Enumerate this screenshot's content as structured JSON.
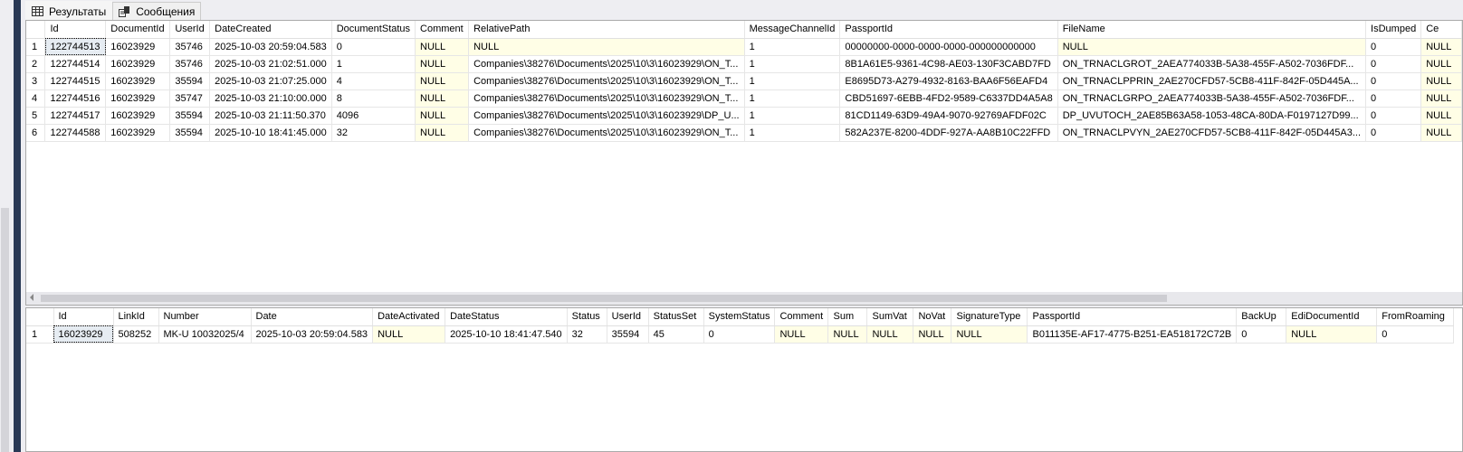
{
  "tabs": [
    {
      "label": "Результаты",
      "icon": "grid-icon"
    },
    {
      "label": "Сообщения",
      "icon": "messages-icon"
    }
  ],
  "grid1": {
    "columns": [
      "",
      "Id",
      "DocumentId",
      "UserId",
      "DateCreated",
      "DocumentStatus",
      "Comment",
      "RelativePath",
      "MessageChannelId",
      "PassportId",
      "FileName",
      "IsDumped",
      "Ce"
    ],
    "rows": [
      [
        "1",
        "122744513",
        "16023929",
        "35746",
        "2025-10-03 20:59:04.583",
        "0",
        "NULL",
        "NULL",
        "1",
        "00000000-0000-0000-0000-000000000000",
        "NULL",
        "0",
        "NULL"
      ],
      [
        "2",
        "122744514",
        "16023929",
        "35746",
        "2025-10-03 21:02:51.000",
        "1",
        "NULL",
        "Companies\\38276\\Documents\\2025\\10\\3\\16023929\\ON_T...",
        "1",
        "8B1A61E5-9361-4C98-AE03-130F3CABD7FD",
        "ON_TRNACLGROT_2AEA774033B-5A38-455F-A502-7036FDF...",
        "0",
        "NULL"
      ],
      [
        "3",
        "122744515",
        "16023929",
        "35594",
        "2025-10-03 21:07:25.000",
        "4",
        "NULL",
        "Companies\\38276\\Documents\\2025\\10\\3\\16023929\\ON_T...",
        "1",
        "E8695D73-A279-4932-8163-BAA6F56EAFD4",
        "ON_TRNACLPPRIN_2AE270CFD57-5CB8-411F-842F-05D445A...",
        "0",
        "NULL"
      ],
      [
        "4",
        "122744516",
        "16023929",
        "35747",
        "2025-10-03 21:10:00.000",
        "8",
        "NULL",
        "Companies\\38276\\Documents\\2025\\10\\3\\16023929\\ON_T...",
        "1",
        "CBD51697-6EBB-4FD2-9589-C6337DD4A5A8",
        "ON_TRNACLGRPO_2AEA774033B-5A38-455F-A502-7036FDF...",
        "0",
        "NULL"
      ],
      [
        "5",
        "122744517",
        "16023929",
        "35594",
        "2025-10-03 21:11:50.370",
        "4096",
        "NULL",
        "Companies\\38276\\Documents\\2025\\10\\3\\16023929\\DP_U...",
        "1",
        "81CD1149-63D9-49A4-9070-92769AFDF02C",
        "DP_UVUTOCH_2AE85B63A58-1053-48CA-80DA-F0197127D99...",
        "0",
        "NULL"
      ],
      [
        "6",
        "122744588",
        "16023929",
        "35594",
        "2025-10-10 18:41:45.000",
        "32",
        "NULL",
        "Companies\\38276\\Documents\\2025\\10\\3\\16023929\\ON_T...",
        "1",
        "582A237E-8200-4DDF-927A-AA8B10C22FFD",
        "ON_TRNACLPVYN_2AE270CFD57-5CB8-411F-842F-05D445A3...",
        "0",
        "NULL"
      ]
    ]
  },
  "grid2": {
    "columns": [
      "",
      "Id",
      "LinkId",
      "Number",
      "Date",
      "DateActivated",
      "DateStatus",
      "Status",
      "UserId",
      "StatusSet",
      "SystemStatus",
      "Comment",
      "Sum",
      "SumVat",
      "NoVat",
      "SignatureType",
      "PassportId",
      "BackUp",
      "EdiDocumentId",
      "FromRoaming"
    ],
    "rows": [
      [
        "1",
        "16023929",
        "508252",
        "MK-U 10032025/4",
        "2025-10-03 20:59:04.583",
        "NULL",
        "2025-10-10 18:41:47.540",
        "32",
        "35594",
        "45",
        "0",
        "NULL",
        "NULL",
        "NULL",
        "NULL",
        "NULL",
        "B011135E-AF17-4775-B251-EA518172C72B",
        "0",
        "NULL",
        "0"
      ]
    ]
  },
  "colors": {
    "null_cell": "#fffee6",
    "selected_cell": "#e6ecf2",
    "side_bar": "#293955"
  }
}
